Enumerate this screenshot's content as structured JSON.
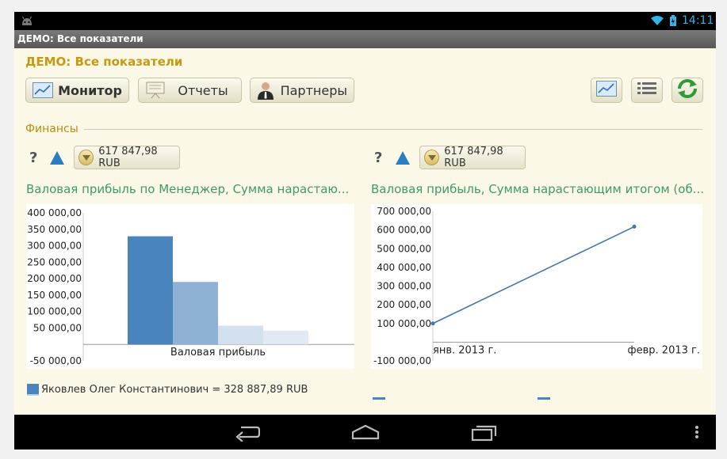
{
  "status": {
    "time": "14:11"
  },
  "window": {
    "title": "ДЕМО: Все показатели"
  },
  "page": {
    "title": "ДЕМО: Все показатели"
  },
  "toolbar": {
    "monitor_label": "Монитор",
    "reports_label": "Отчеты",
    "partners_label": "Партнеры"
  },
  "section": {
    "label": "Финансы"
  },
  "widgets": [
    {
      "help": "?",
      "value": "617 847,98 RUB",
      "title": "Валовая прибыль по Менеджер, Сумма нарастаю..."
    },
    {
      "help": "?",
      "value": "617 847,98 RUB",
      "title": "Валовая прибыль, Сумма нарастающим итогом (об..."
    }
  ],
  "legend": {
    "text": "Яковлев Олег Константинович = 328 887,89 RUB"
  },
  "colors": {
    "accent": "#c49a12",
    "chart_green": "#3f9a6a",
    "bar_dark": "#4a84bd",
    "status": "#33b5e5"
  },
  "chart_data": [
    {
      "type": "bar",
      "categories": [
        "Валовая прибыль"
      ],
      "series": [
        {
          "name": "Яковлев Олег Константинович",
          "values": [
            328887.89
          ],
          "color": "#4a84bd"
        },
        {
          "values": [
            190000
          ],
          "color": "#8fb1d6"
        },
        {
          "values": [
            57000
          ],
          "color": "#d3e1ef"
        },
        {
          "values": [
            42000
          ],
          "color": "#e1eaf4"
        }
      ],
      "ylim": [
        -50000,
        400000
      ],
      "yticks": [
        "400 000,00",
        "350 000,00",
        "300 000,00",
        "250 000,00",
        "200 000,00",
        "150 000,00",
        "100 000,00",
        "50 000,00",
        "-50 000,00"
      ],
      "ytick_values": [
        400000,
        350000,
        300000,
        250000,
        200000,
        150000,
        100000,
        50000,
        -50000
      ]
    },
    {
      "type": "line",
      "x": [
        "янв. 2013 г.",
        "февр. 2013 г."
      ],
      "values": [
        100000,
        617847.98
      ],
      "ylim": [
        -100000,
        700000
      ],
      "yticks": [
        "700 000,00",
        "600 000,00",
        "500 000,00",
        "400 000,00",
        "300 000,00",
        "200 000,00",
        "100 000,00",
        "-100 000,00"
      ],
      "ytick_values": [
        700000,
        600000,
        500000,
        400000,
        300000,
        200000,
        100000,
        -100000
      ],
      "color": "#3f78b0"
    }
  ]
}
